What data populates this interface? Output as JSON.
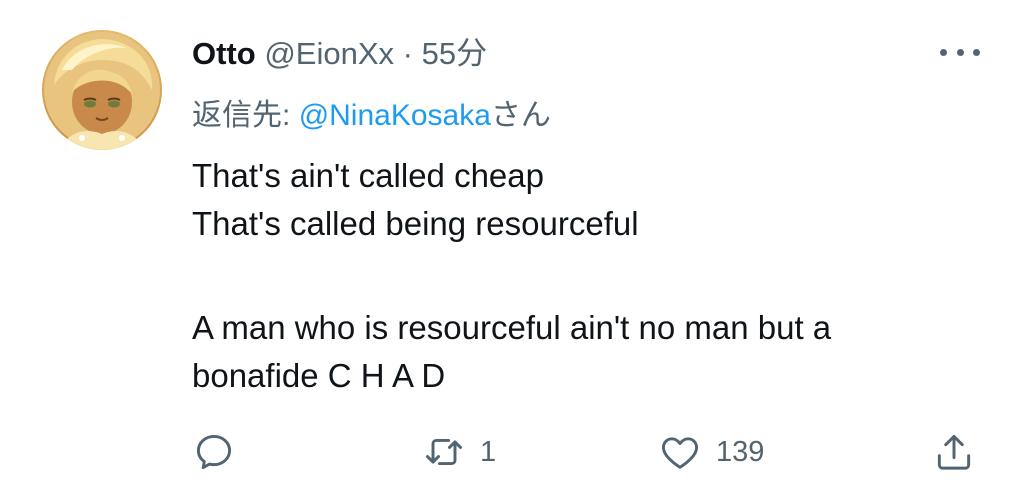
{
  "tweet": {
    "author_name": "Otto",
    "author_handle": "@EionXx",
    "separator": "·",
    "time": "55分",
    "reply_prefix": "返信先:",
    "reply_mention": "@NinaKosaka",
    "reply_suffix": "さん",
    "lines": [
      "That's ain't called cheap",
      "That's called being resourceful",
      "A man who is resourceful ain't no man but a",
      "bonafide C H A D"
    ]
  },
  "actions": {
    "reply": {
      "icon": "comment-icon"
    },
    "retweet": {
      "icon": "retweet-icon",
      "count": "1"
    },
    "like": {
      "icon": "heart-icon",
      "count": "139"
    },
    "share": {
      "icon": "share-icon"
    }
  },
  "colors": {
    "text": "#0f1419",
    "secondary": "#536471",
    "link": "#1d9bf0"
  }
}
